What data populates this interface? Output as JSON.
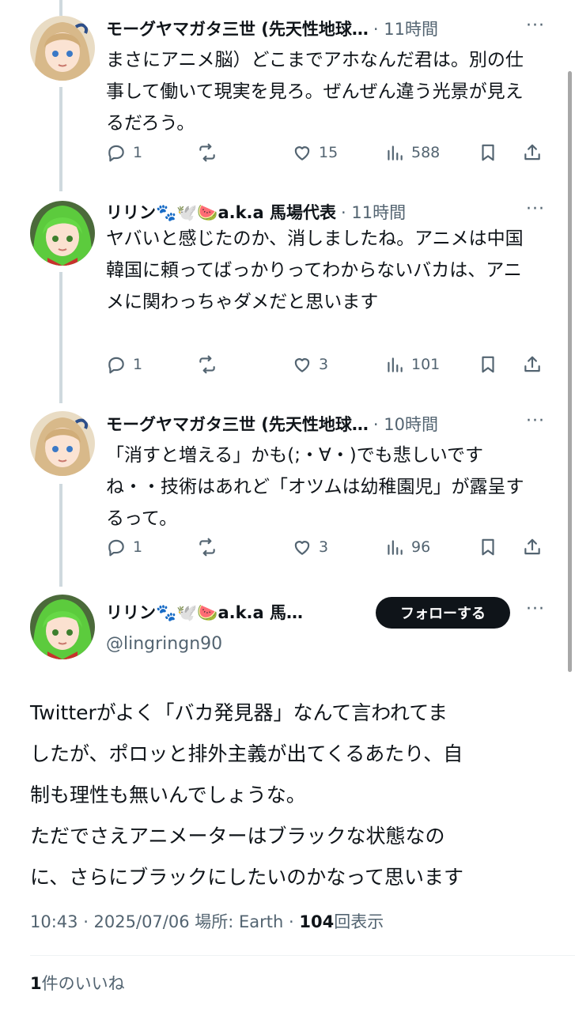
{
  "replies": [
    {
      "name": "モーグヤマガタ三世 (先天性地球…",
      "time": "· 11時間",
      "more": "···",
      "text": "まさにアニメ脳）どこまでアホなんだ君は。別の仕事して働いて現実を見ろ。ぜんぜん違う光景が見えるだろう。",
      "replies": "1",
      "retweets": "",
      "likes": "15",
      "views": "588"
    },
    {
      "name": "リリン🐾🕊️🍉a.k.a 馬場代表",
      "time": "· 11時間",
      "more": "···",
      "text": "ヤバいと感じたのか、消しましたね。アニメは中国韓国に頼ってばっかりってわからないバカは、アニメに関わっちゃダメだと思います",
      "replies": "1",
      "retweets": "",
      "likes": "3",
      "views": "101"
    },
    {
      "name": "モーグヤマガタ三世 (先天性地球…",
      "time": "· 10時間",
      "more": "···",
      "text": "「消すと増える」かも(;・∀・)でも悲しいですね・・技術はあれど「オツムは幼稚園児」が露呈するって。",
      "replies": "1",
      "retweets": "",
      "likes": "3",
      "views": "96"
    }
  ],
  "main_tweet": {
    "name": "リリン🐾🕊️🍉a.k.a 馬…",
    "handle": "@lingringn90",
    "follow_label": "フォローする",
    "more": "···",
    "text_lines": [
      "Twitterがよく「バカ発見器」なんて言われてま",
      "したが、ポロッと排外主義が出てくるあたり、自",
      "制も理性も無いんでしょうな。",
      "ただでさえアニメーターはブラックな状態なの",
      "に、さらにブラックにしたいのかなって思います"
    ],
    "timestamp": "10:43 · 2025/07/06 場所: Earth · ",
    "view_count": "104",
    "view_label": "回表示",
    "like_count": "1",
    "like_label": "件のいいね"
  }
}
